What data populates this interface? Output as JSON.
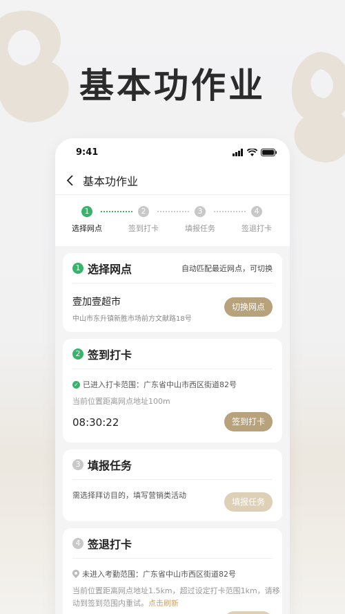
{
  "hero": {
    "title": "基本功作业"
  },
  "status_bar": {
    "time": "9:41"
  },
  "nav": {
    "title": "基本功作业"
  },
  "steps": [
    {
      "num": "1",
      "label": "选择网点",
      "active": true
    },
    {
      "num": "2",
      "label": "签到打卡",
      "active": false
    },
    {
      "num": "3",
      "label": "填报任务",
      "active": false
    },
    {
      "num": "4",
      "label": "签退打卡",
      "active": false
    }
  ],
  "card1": {
    "num": "1",
    "title": "选择网点",
    "hint": "自动匹配最近网点，可切换",
    "store_name": "壹加壹超市",
    "store_address": "中山市东升镇新胜市场前方文献路18号",
    "button": "切换网点"
  },
  "card2": {
    "num": "2",
    "title": "签到打卡",
    "status": "已进入打卡范围：广东省中山市西区街道82号",
    "distance": "当前位置距离网点地址100m",
    "time": "08:30:22",
    "button": "签到打卡"
  },
  "card3": {
    "num": "3",
    "title": "填报任务",
    "desc": "需选择拜访目的，填写营销类活动",
    "button": "填报任务"
  },
  "card4": {
    "num": "4",
    "title": "签退打卡",
    "status": "未进入考勤范围：广东省中山市西区街道82号",
    "desc_line1": "当前位置距离网点地址1.5km，超过设定打卡范围1km，请移",
    "desc_line2": "动到签到范围内重试。",
    "refresh": "点击刷新"
  },
  "colors": {
    "accent_green": "#35b46a",
    "accent_gold": "#b8a27b",
    "disabled_gold": "#ddd0b7"
  }
}
